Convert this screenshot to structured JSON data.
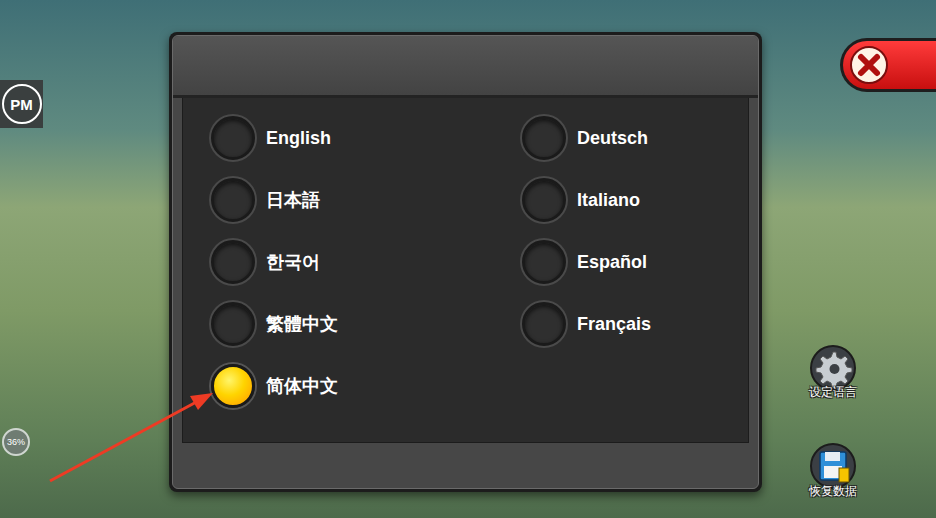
{
  "hud": {
    "badge": "PM",
    "progress": "36%"
  },
  "dialog": {
    "languages": [
      {
        "label": "English",
        "selected": false
      },
      {
        "label": "日本語",
        "selected": false
      },
      {
        "label": "한국어",
        "selected": false
      },
      {
        "label": "繁體中文",
        "selected": false
      },
      {
        "label": "简体中文",
        "selected": true
      },
      {
        "label": "Deutsch",
        "selected": false
      },
      {
        "label": "Italiano",
        "selected": false
      },
      {
        "label": "Español",
        "selected": false
      },
      {
        "label": "Français",
        "selected": false
      }
    ]
  },
  "side_buttons": [
    {
      "label": "设定语言"
    },
    {
      "label": "恢复数据"
    }
  ]
}
